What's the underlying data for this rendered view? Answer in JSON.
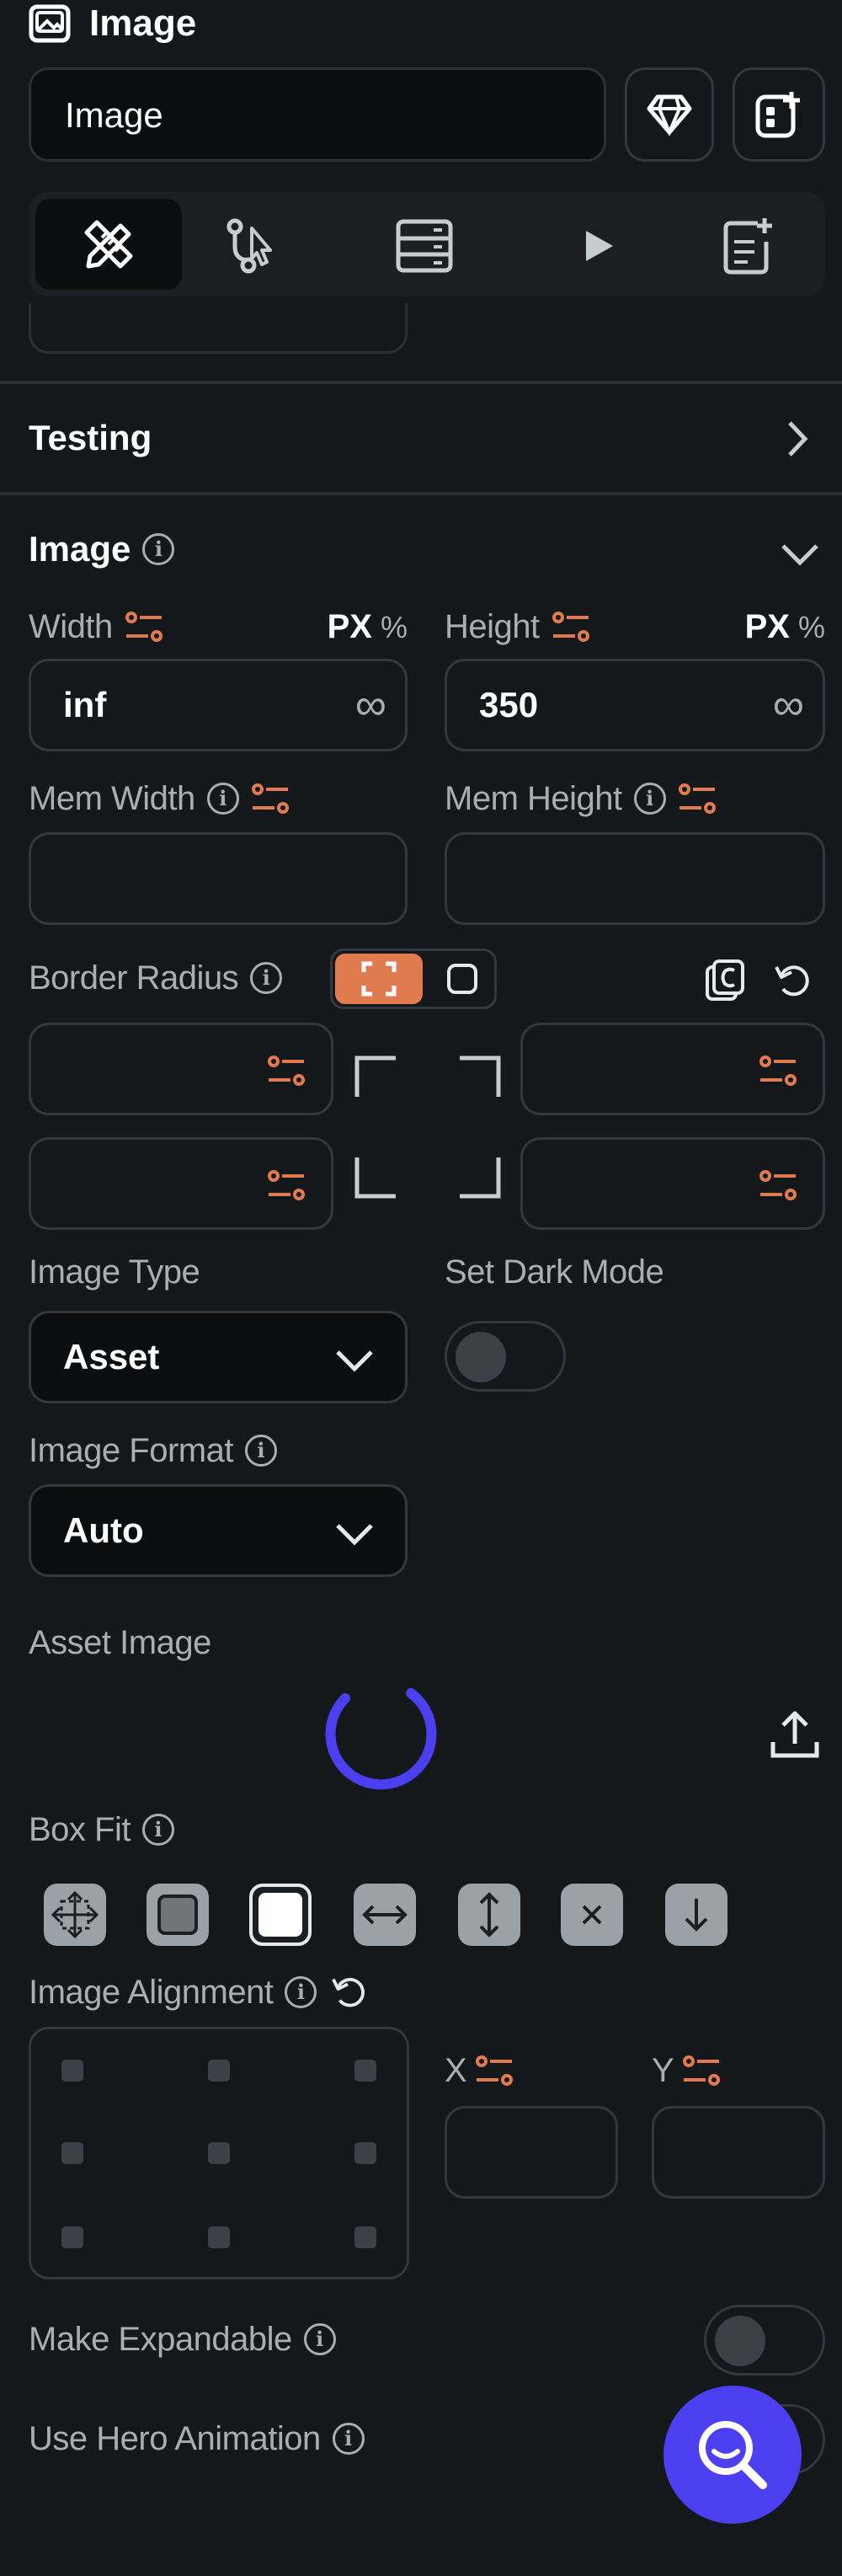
{
  "header": {
    "title": "Image",
    "name_value": "Image"
  },
  "tabs": [
    {
      "name": "properties",
      "active": true
    },
    {
      "name": "actions"
    },
    {
      "name": "backend-query"
    },
    {
      "name": "animations"
    },
    {
      "name": "widget-state"
    }
  ],
  "testing": {
    "label": "Testing"
  },
  "image_section": {
    "title": "Image",
    "width": {
      "label": "Width",
      "unit_px": "PX",
      "unit_pct": "%",
      "value": "inf",
      "infinity": "∞"
    },
    "height": {
      "label": "Height",
      "unit_px": "PX",
      "unit_pct": "%",
      "value": "350",
      "infinity": "∞"
    },
    "mem_width": {
      "label": "Mem Width",
      "value": ""
    },
    "mem_height": {
      "label": "Mem Height",
      "value": ""
    },
    "border_radius": {
      "label": "Border Radius"
    },
    "image_type": {
      "label": "Image Type",
      "value": "Asset"
    },
    "dark_mode": {
      "label": "Set Dark Mode",
      "on": false
    },
    "image_format": {
      "label": "Image Format",
      "value": "Auto"
    },
    "asset_image": {
      "label": "Asset Image"
    },
    "box_fit": {
      "label": "Box Fit"
    },
    "image_alignment": {
      "label": "Image Alignment",
      "x_label": "X",
      "y_label": "Y"
    },
    "make_expandable": {
      "label": "Make Expandable",
      "on": false
    },
    "hero_animation": {
      "label": "Use Hero Animation",
      "on": false
    }
  },
  "colors": {
    "accent": "#e07b4f",
    "spinner": "#4b3ff0",
    "fab": "#4b3ff0",
    "panel": "#14181b"
  }
}
